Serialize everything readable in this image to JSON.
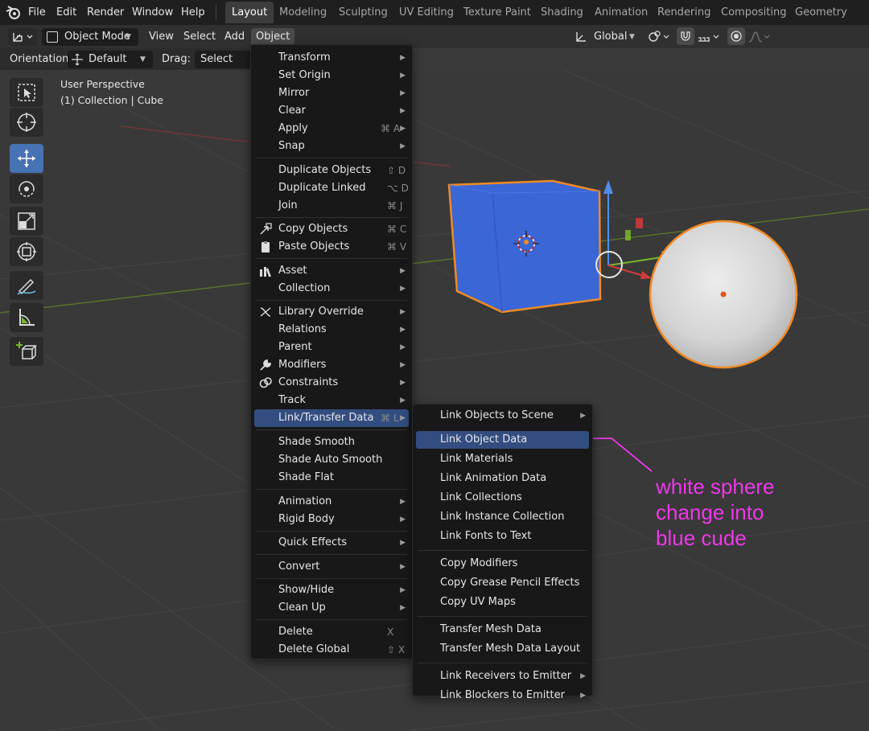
{
  "topbar": {
    "menus": [
      "File",
      "Edit",
      "Render",
      "Window",
      "Help"
    ],
    "workspaces": [
      "Layout",
      "Modeling",
      "Sculpting",
      "UV Editing",
      "Texture Paint",
      "Shading",
      "Animation",
      "Rendering",
      "Compositing",
      "Geometry Nodes"
    ]
  },
  "header": {
    "mode": "Object Mode",
    "menus": [
      "View",
      "Select",
      "Add",
      "Object"
    ],
    "orientation_global": "Global"
  },
  "tool_settings": {
    "orientation_label": "Orientation:",
    "orientation_value": "Default",
    "drag_label": "Drag:",
    "drag_value": "Select Box"
  },
  "viewport": {
    "view_name": "User Perspective",
    "collection_info": "(1) Collection | Cube"
  },
  "object_menu": {
    "items": [
      {
        "label": "Transform",
        "shortcut": "",
        "submenu": true,
        "icon": ""
      },
      {
        "label": "Set Origin",
        "shortcut": "",
        "submenu": true,
        "icon": ""
      },
      {
        "label": "Mirror",
        "shortcut": "",
        "submenu": true,
        "icon": ""
      },
      {
        "label": "Clear",
        "shortcut": "",
        "submenu": true,
        "icon": ""
      },
      {
        "label": "Apply",
        "shortcut": "⌘ A",
        "submenu": true,
        "icon": ""
      },
      {
        "label": "Snap",
        "shortcut": "",
        "submenu": true,
        "icon": ""
      },
      {
        "label": "Duplicate Objects",
        "shortcut": "⇧ D",
        "submenu": false,
        "icon": ""
      },
      {
        "label": "Duplicate Linked",
        "shortcut": "⌥ D",
        "submenu": false,
        "icon": ""
      },
      {
        "label": "Join",
        "shortcut": "⌘ J",
        "submenu": false,
        "icon": ""
      },
      {
        "label": "Copy Objects",
        "shortcut": "⌘ C",
        "submenu": false,
        "icon": "copy-icon"
      },
      {
        "label": "Paste Objects",
        "shortcut": "⌘ V",
        "submenu": false,
        "icon": "paste-icon"
      },
      {
        "label": "Asset",
        "shortcut": "",
        "submenu": true,
        "icon": "asset-icon"
      },
      {
        "label": "Collection",
        "shortcut": "",
        "submenu": true,
        "icon": ""
      },
      {
        "label": "Library Override",
        "shortcut": "",
        "submenu": true,
        "icon": "library-override-icon"
      },
      {
        "label": "Relations",
        "shortcut": "",
        "submenu": true,
        "icon": ""
      },
      {
        "label": "Parent",
        "shortcut": "",
        "submenu": true,
        "icon": ""
      },
      {
        "label": "Modifiers",
        "shortcut": "",
        "submenu": true,
        "icon": "wrench-icon"
      },
      {
        "label": "Constraints",
        "shortcut": "",
        "submenu": true,
        "icon": "constraint-icon"
      },
      {
        "label": "Track",
        "shortcut": "",
        "submenu": true,
        "icon": ""
      },
      {
        "label": "Link/Transfer Data",
        "shortcut": "⌘ L",
        "submenu": true,
        "icon": ""
      },
      {
        "label": "Shade Smooth",
        "shortcut": "",
        "submenu": false,
        "icon": ""
      },
      {
        "label": "Shade Auto Smooth",
        "shortcut": "",
        "submenu": false,
        "icon": ""
      },
      {
        "label": "Shade Flat",
        "shortcut": "",
        "submenu": false,
        "icon": ""
      },
      {
        "label": "Animation",
        "shortcut": "",
        "submenu": true,
        "icon": ""
      },
      {
        "label": "Rigid Body",
        "shortcut": "",
        "submenu": true,
        "icon": ""
      },
      {
        "label": "Quick Effects",
        "shortcut": "",
        "submenu": true,
        "icon": ""
      },
      {
        "label": "Convert",
        "shortcut": "",
        "submenu": true,
        "icon": ""
      },
      {
        "label": "Show/Hide",
        "shortcut": "",
        "submenu": true,
        "icon": ""
      },
      {
        "label": "Clean Up",
        "shortcut": "",
        "submenu": true,
        "icon": ""
      },
      {
        "label": "Delete",
        "shortcut": "X",
        "submenu": false,
        "icon": ""
      },
      {
        "label": "Delete Global",
        "shortcut": "⇧ X",
        "submenu": false,
        "icon": ""
      }
    ]
  },
  "link_submenu": {
    "items": [
      {
        "label": "Link Objects to Scene",
        "submenu": true
      },
      {
        "label": "Link Object Data",
        "submenu": false
      },
      {
        "label": "Link Materials",
        "submenu": false
      },
      {
        "label": "Link Animation Data",
        "submenu": false
      },
      {
        "label": "Link Collections",
        "submenu": false
      },
      {
        "label": "Link Instance Collection",
        "submenu": false
      },
      {
        "label": "Link Fonts to Text",
        "submenu": false
      },
      {
        "label": "Copy Modifiers",
        "submenu": false
      },
      {
        "label": "Copy Grease Pencil Effects",
        "submenu": false
      },
      {
        "label": "Copy UV Maps",
        "submenu": false
      },
      {
        "label": "Transfer Mesh Data",
        "submenu": false
      },
      {
        "label": "Transfer Mesh Data Layout",
        "submenu": false
      },
      {
        "label": "Link Receivers to Emitter",
        "submenu": true
      },
      {
        "label": "Link Blockers to Emitter",
        "submenu": true
      }
    ]
  },
  "annotation": {
    "lines": [
      "white sphere",
      "change into",
      "blue cude"
    ],
    "color": "#ee38e9"
  },
  "colors": {
    "selection": "#334d80",
    "accent": "#4772b3",
    "cube": "#3a66d6",
    "outline": "#f08a24"
  }
}
